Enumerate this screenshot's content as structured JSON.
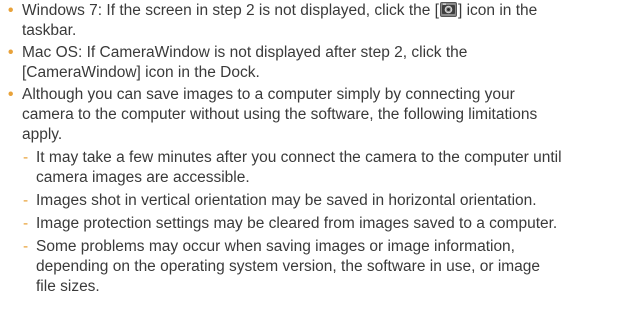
{
  "colors": {
    "text": "#3a3a3a",
    "bullet": "#e8a23a",
    "dash": "#e8a23a"
  },
  "bullets": [
    {
      "marker": "•",
      "lines": [
        "Windows 7: If the screen in step 2 is not displayed, click the [",
        "] icon in the",
        "taskbar."
      ],
      "icon": "camera-window-icon"
    },
    {
      "marker": "•",
      "lines": [
        "Mac OS: If CameraWindow is not displayed after step 2, click the",
        "[CameraWindow] icon in the Dock."
      ]
    },
    {
      "marker": "•",
      "lines": [
        "Although you can save images to a computer simply by connecting your",
        "camera to the computer without using the software, the following limitations",
        "apply."
      ],
      "subitems": [
        {
          "marker": "-",
          "lines": [
            "It may take a few minutes after you connect the camera to the computer until",
            "camera images are accessible."
          ]
        },
        {
          "marker": "-",
          "lines": [
            "Images shot in vertical orientation may be saved in horizontal orientation."
          ]
        },
        {
          "marker": "-",
          "lines": [
            "Image protection settings may be cleared from images saved to a computer."
          ]
        },
        {
          "marker": "-",
          "lines": [
            "Some problems may occur when saving images or image information,",
            "depending on the operating system version, the software in use, or image",
            "file sizes."
          ]
        }
      ]
    }
  ]
}
